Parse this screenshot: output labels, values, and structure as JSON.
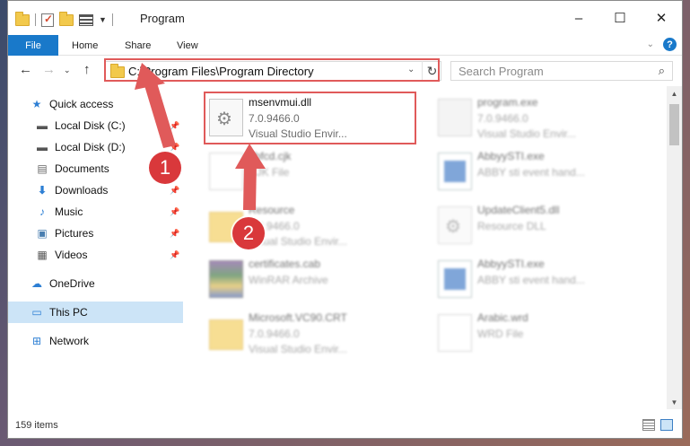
{
  "window": {
    "title": "Program",
    "controls": [
      "–",
      "☐",
      "✕"
    ]
  },
  "ribbon": {
    "tabs": [
      "File",
      "Home",
      "Share",
      "View"
    ]
  },
  "address": {
    "path": "C:\\Program Files\\Program Directory",
    "search_placeholder": "Search Program"
  },
  "nav_pane": {
    "items": [
      {
        "label": "Quick access",
        "icon": "star-icon",
        "pinned": false,
        "selected": false
      },
      {
        "label": "Local Disk (C:)",
        "icon": "drive-icon",
        "pinned": true,
        "selected": false
      },
      {
        "label": "Local Disk (D:)",
        "icon": "drive-icon",
        "pinned": true,
        "selected": false
      },
      {
        "label": "Documents",
        "icon": "document-icon",
        "pinned": true,
        "selected": false
      },
      {
        "label": "Downloads",
        "icon": "download-icon",
        "pinned": true,
        "selected": false
      },
      {
        "label": "Music",
        "icon": "music-icon",
        "pinned": true,
        "selected": false
      },
      {
        "label": "Pictures",
        "icon": "pictures-icon",
        "pinned": true,
        "selected": false
      },
      {
        "label": "Videos",
        "icon": "videos-icon",
        "pinned": true,
        "selected": false
      },
      {
        "label": "OneDrive",
        "icon": "cloud-icon",
        "pinned": false,
        "selected": false
      },
      {
        "label": "This PC",
        "icon": "monitor-icon",
        "pinned": false,
        "selected": true
      },
      {
        "label": "Network",
        "icon": "network-icon",
        "pinned": false,
        "selected": false
      }
    ]
  },
  "files": [
    {
      "name": "msenvmui.dll",
      "line1": "7.0.9466.0",
      "line2": "Visual Studio Envir...",
      "icon": "dll-icon",
      "highlighted": true
    },
    {
      "name": "program.exe",
      "line1": "7.0.9466.0",
      "line2": "Visual Studio Envir...",
      "icon": "exe-icon",
      "highlighted": false
    },
    {
      "name": "dbfcd.cjk",
      "line1": "CJK File",
      "line2": "",
      "icon": "text-file-icon",
      "highlighted": false
    },
    {
      "name": "AbbyySTI.exe",
      "line1": "ABBY sti event hand...",
      "line2": "",
      "icon": "app-icon",
      "highlighted": false
    },
    {
      "name": "Resource",
      "line1": "7.0.9466.0",
      "line2": "Visual Studio Envir...",
      "icon": "folder-icon",
      "highlighted": false
    },
    {
      "name": "UpdateClient5.dll",
      "line1": "Resource DLL",
      "line2": "",
      "icon": "dll-icon",
      "highlighted": false
    },
    {
      "name": "certificates.cab",
      "line1": "WinRAR Archive",
      "line2": "",
      "icon": "archive-icon",
      "highlighted": false
    },
    {
      "name": "AbbyySTI.exe",
      "line1": "ABBY sti event hand...",
      "line2": "",
      "icon": "app-icon",
      "highlighted": false
    },
    {
      "name": "Microsoft.VC90.CRT",
      "line1": "7.0.9466.0",
      "line2": "Visual Studio Envir...",
      "icon": "folder-icon",
      "highlighted": false
    },
    {
      "name": "Arabic.wrd",
      "line1": "WRD File",
      "line2": "",
      "icon": "text-file-icon",
      "highlighted": false
    }
  ],
  "status": {
    "item_count": "159 items"
  },
  "annotations": {
    "step1": "1",
    "step2": "2",
    "color": "#e05a5a"
  }
}
